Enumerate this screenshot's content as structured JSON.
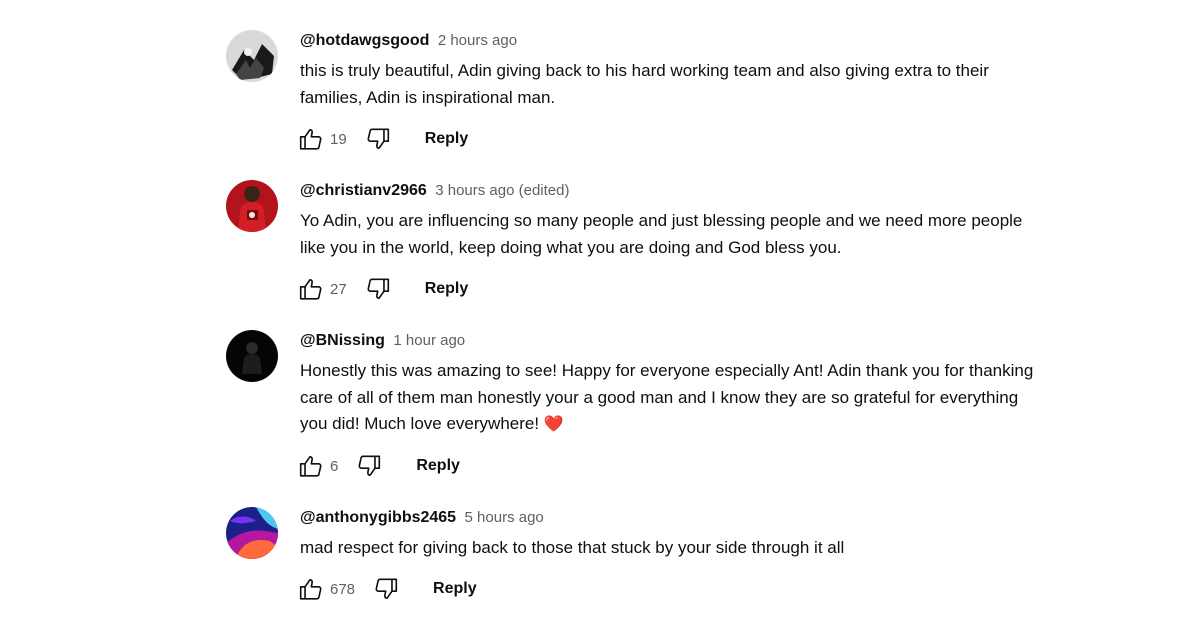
{
  "comments": [
    {
      "author": "@hotdawgsgood",
      "time": "2 hours ago",
      "text": "this is truly beautiful, Adin giving back to his hard working team and also giving extra to their families, Adin is inspirational man.",
      "likes": "19",
      "reply_label": "Reply"
    },
    {
      "author": "@christianv2966",
      "time": "3 hours ago (edited)",
      "text": "Yo Adin, you are influencing so many people and just blessing people and we need more people like you in the world, keep doing what you are doing and God bless you.",
      "likes": "27",
      "reply_label": "Reply"
    },
    {
      "author": "@BNissing",
      "time": "1 hour ago",
      "text": "Honestly this was amazing to see! Happy for everyone especially Ant! Adin thank you for thanking care of all of them man honestly your a good man and I know they are so grateful for everything you did! Much love everywhere!",
      "emoji": "❤️",
      "likes": "6",
      "reply_label": "Reply"
    },
    {
      "author": "@anthonygibbs2465",
      "time": "5 hours ago",
      "text": "mad respect for giving back to those that stuck by your side through it all",
      "likes": "678",
      "reply_label": "Reply"
    }
  ],
  "icons": {
    "like": "thumbs-up-icon",
    "dislike": "thumbs-down-icon"
  },
  "colors": {
    "text": "#0f0f0f",
    "secondary": "#606060",
    "heart": "#e0282c"
  }
}
